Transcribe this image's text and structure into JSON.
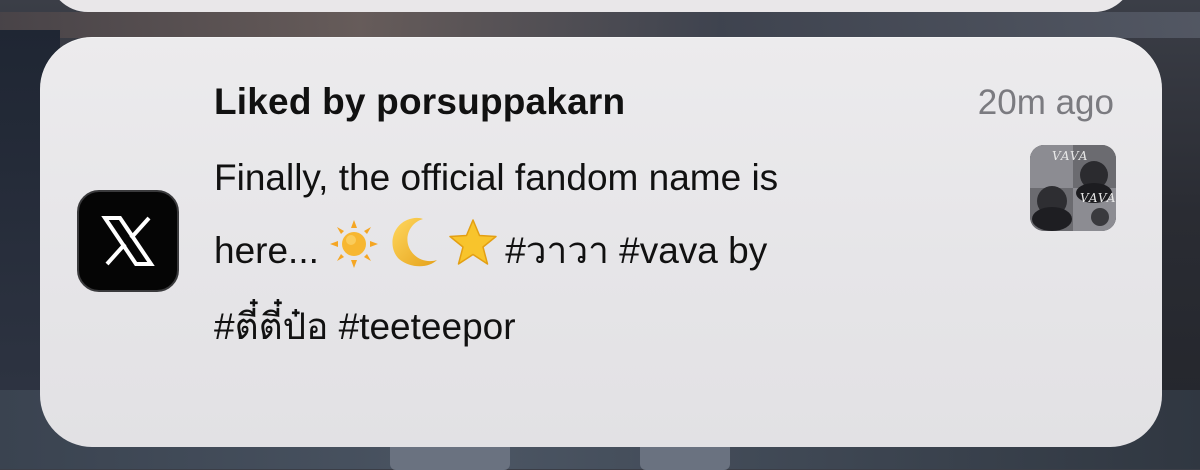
{
  "notification": {
    "title": "Liked by porsuppakarn",
    "timestamp": "20m ago",
    "body": {
      "line1": "Finally, the official fandom name is",
      "line2_text_start": "here... ",
      "line2_text_end": "#วาวา #vava by",
      "line3": "#ตี๋ตี๋ป๋อ #teeteepor"
    },
    "app": {
      "name": "X",
      "icon": "x-logo-icon"
    },
    "thumbnail": {
      "title_top": "VAVA",
      "title_mid": "VAVA",
      "icon": "album-cover-thumbnail"
    },
    "emojis": [
      "sun-icon",
      "crescent-moon-icon",
      "star-icon"
    ]
  },
  "colors": {
    "card_bg": "#e8e7ea",
    "title_text": "#111111",
    "timestamp_text": "#7b7b80",
    "app_icon_bg": "#050505"
  }
}
